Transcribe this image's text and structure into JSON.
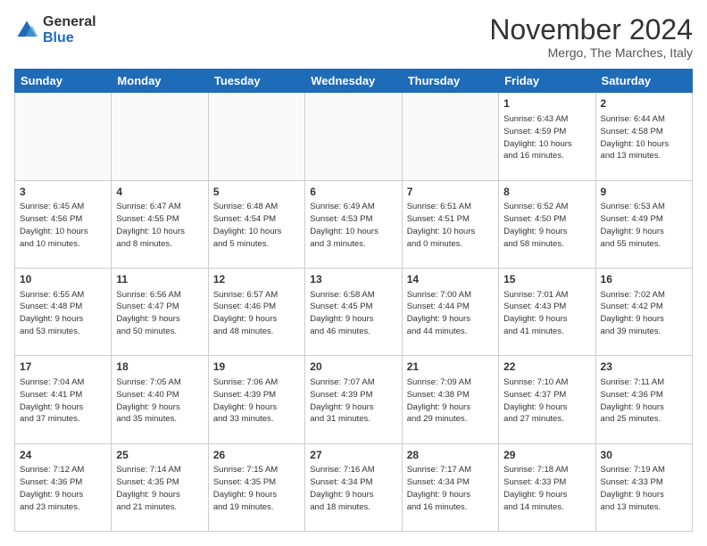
{
  "logo": {
    "general": "General",
    "blue": "Blue"
  },
  "title": "November 2024",
  "subtitle": "Mergo, The Marches, Italy",
  "days_header": [
    "Sunday",
    "Monday",
    "Tuesday",
    "Wednesday",
    "Thursday",
    "Friday",
    "Saturday"
  ],
  "weeks": [
    [
      {
        "day": "",
        "info": ""
      },
      {
        "day": "",
        "info": ""
      },
      {
        "day": "",
        "info": ""
      },
      {
        "day": "",
        "info": ""
      },
      {
        "day": "",
        "info": ""
      },
      {
        "day": "1",
        "info": "Sunrise: 6:43 AM\nSunset: 4:59 PM\nDaylight: 10 hours\nand 16 minutes."
      },
      {
        "day": "2",
        "info": "Sunrise: 6:44 AM\nSunset: 4:58 PM\nDaylight: 10 hours\nand 13 minutes."
      }
    ],
    [
      {
        "day": "3",
        "info": "Sunrise: 6:45 AM\nSunset: 4:56 PM\nDaylight: 10 hours\nand 10 minutes."
      },
      {
        "day": "4",
        "info": "Sunrise: 6:47 AM\nSunset: 4:55 PM\nDaylight: 10 hours\nand 8 minutes."
      },
      {
        "day": "5",
        "info": "Sunrise: 6:48 AM\nSunset: 4:54 PM\nDaylight: 10 hours\nand 5 minutes."
      },
      {
        "day": "6",
        "info": "Sunrise: 6:49 AM\nSunset: 4:53 PM\nDaylight: 10 hours\nand 3 minutes."
      },
      {
        "day": "7",
        "info": "Sunrise: 6:51 AM\nSunset: 4:51 PM\nDaylight: 10 hours\nand 0 minutes."
      },
      {
        "day": "8",
        "info": "Sunrise: 6:52 AM\nSunset: 4:50 PM\nDaylight: 9 hours\nand 58 minutes."
      },
      {
        "day": "9",
        "info": "Sunrise: 6:53 AM\nSunset: 4:49 PM\nDaylight: 9 hours\nand 55 minutes."
      }
    ],
    [
      {
        "day": "10",
        "info": "Sunrise: 6:55 AM\nSunset: 4:48 PM\nDaylight: 9 hours\nand 53 minutes."
      },
      {
        "day": "11",
        "info": "Sunrise: 6:56 AM\nSunset: 4:47 PM\nDaylight: 9 hours\nand 50 minutes."
      },
      {
        "day": "12",
        "info": "Sunrise: 6:57 AM\nSunset: 4:46 PM\nDaylight: 9 hours\nand 48 minutes."
      },
      {
        "day": "13",
        "info": "Sunrise: 6:58 AM\nSunset: 4:45 PM\nDaylight: 9 hours\nand 46 minutes."
      },
      {
        "day": "14",
        "info": "Sunrise: 7:00 AM\nSunset: 4:44 PM\nDaylight: 9 hours\nand 44 minutes."
      },
      {
        "day": "15",
        "info": "Sunrise: 7:01 AM\nSunset: 4:43 PM\nDaylight: 9 hours\nand 41 minutes."
      },
      {
        "day": "16",
        "info": "Sunrise: 7:02 AM\nSunset: 4:42 PM\nDaylight: 9 hours\nand 39 minutes."
      }
    ],
    [
      {
        "day": "17",
        "info": "Sunrise: 7:04 AM\nSunset: 4:41 PM\nDaylight: 9 hours\nand 37 minutes."
      },
      {
        "day": "18",
        "info": "Sunrise: 7:05 AM\nSunset: 4:40 PM\nDaylight: 9 hours\nand 35 minutes."
      },
      {
        "day": "19",
        "info": "Sunrise: 7:06 AM\nSunset: 4:39 PM\nDaylight: 9 hours\nand 33 minutes."
      },
      {
        "day": "20",
        "info": "Sunrise: 7:07 AM\nSunset: 4:39 PM\nDaylight: 9 hours\nand 31 minutes."
      },
      {
        "day": "21",
        "info": "Sunrise: 7:09 AM\nSunset: 4:38 PM\nDaylight: 9 hours\nand 29 minutes."
      },
      {
        "day": "22",
        "info": "Sunrise: 7:10 AM\nSunset: 4:37 PM\nDaylight: 9 hours\nand 27 minutes."
      },
      {
        "day": "23",
        "info": "Sunrise: 7:11 AM\nSunset: 4:36 PM\nDaylight: 9 hours\nand 25 minutes."
      }
    ],
    [
      {
        "day": "24",
        "info": "Sunrise: 7:12 AM\nSunset: 4:36 PM\nDaylight: 9 hours\nand 23 minutes."
      },
      {
        "day": "25",
        "info": "Sunrise: 7:14 AM\nSunset: 4:35 PM\nDaylight: 9 hours\nand 21 minutes."
      },
      {
        "day": "26",
        "info": "Sunrise: 7:15 AM\nSunset: 4:35 PM\nDaylight: 9 hours\nand 19 minutes."
      },
      {
        "day": "27",
        "info": "Sunrise: 7:16 AM\nSunset: 4:34 PM\nDaylight: 9 hours\nand 18 minutes."
      },
      {
        "day": "28",
        "info": "Sunrise: 7:17 AM\nSunset: 4:34 PM\nDaylight: 9 hours\nand 16 minutes."
      },
      {
        "day": "29",
        "info": "Sunrise: 7:18 AM\nSunset: 4:33 PM\nDaylight: 9 hours\nand 14 minutes."
      },
      {
        "day": "30",
        "info": "Sunrise: 7:19 AM\nSunset: 4:33 PM\nDaylight: 9 hours\nand 13 minutes."
      }
    ]
  ]
}
